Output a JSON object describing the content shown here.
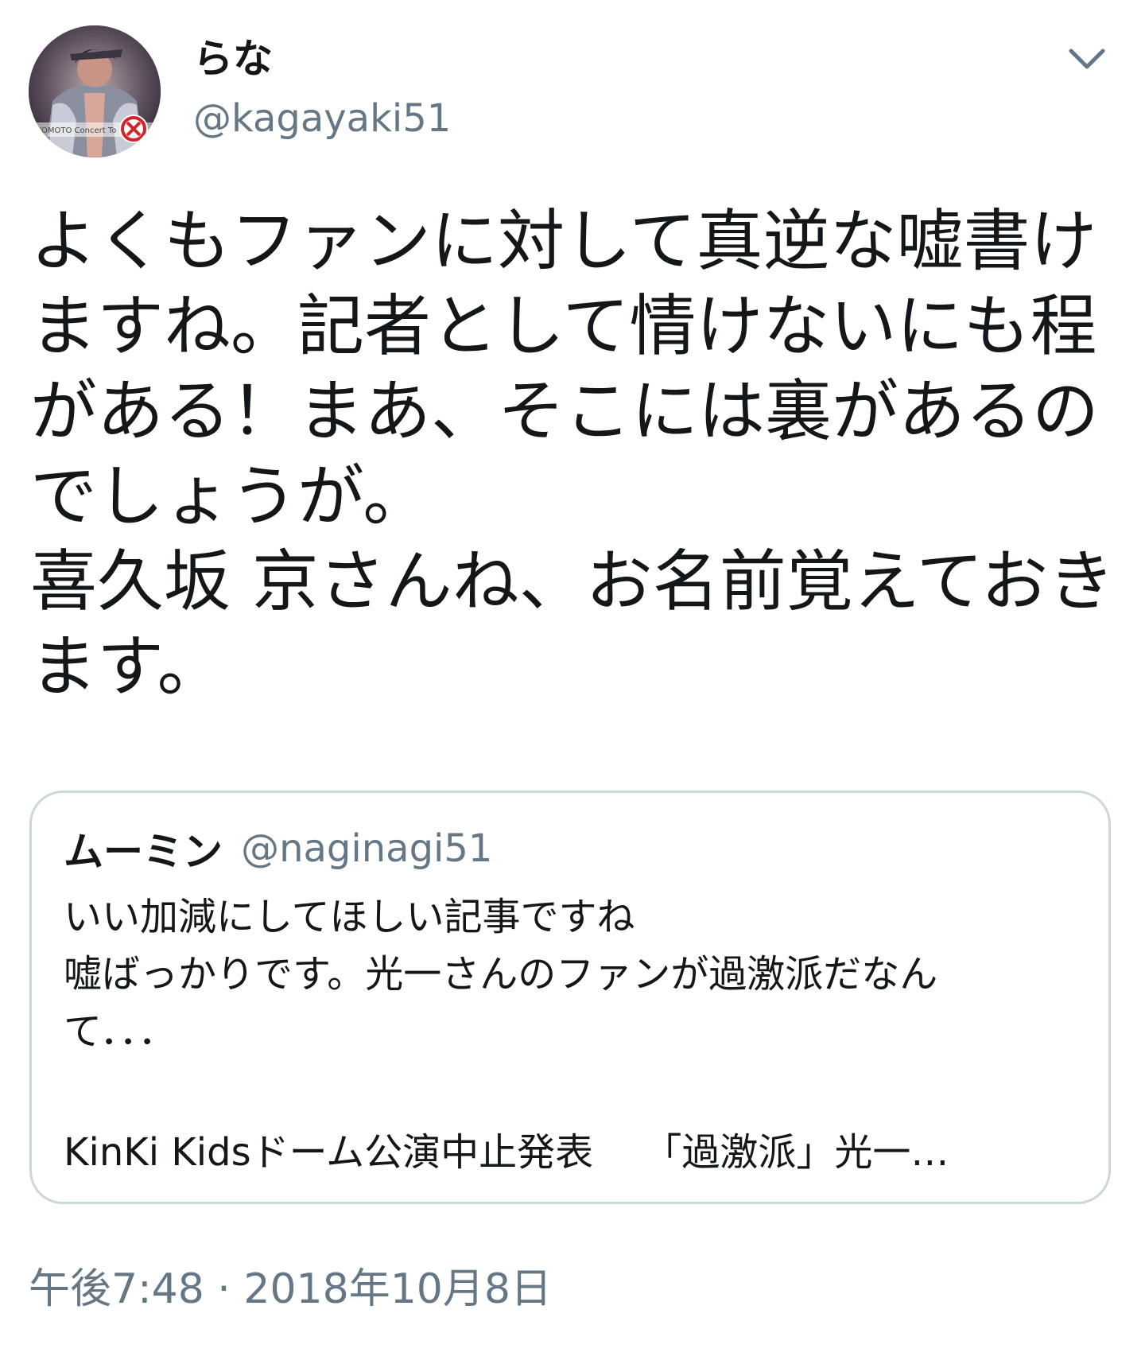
{
  "tweet": {
    "author": {
      "display_name": "らな",
      "handle": "@kagayaki51",
      "avatar_text": "KOMOTO Concert To"
    },
    "menu_icon": "chevron-down-icon",
    "text": "よくもファンに対して真逆な嘘書け\nますね。記者として情けないにも程\nがある！まあ、そこには裏があるの\nでしょうが。\n喜久坂 京さんね、お名前覚えておき\nます。",
    "quoted": {
      "display_name": "ムーミン",
      "handle": "@naginagi51",
      "text": "いい加減にしてほしい記事ですね\n嘘ばっかりです。光一さんのファンが過激派だなん\nて．．．",
      "link_title": "KinKi Kidsドーム公演中止発表　 「過激派」光一…"
    },
    "timestamp": "午後7:48 · 2018年10月8日"
  },
  "colors": {
    "text_primary": "#14171a",
    "text_secondary": "#657786",
    "border": "#ccd6dd"
  }
}
